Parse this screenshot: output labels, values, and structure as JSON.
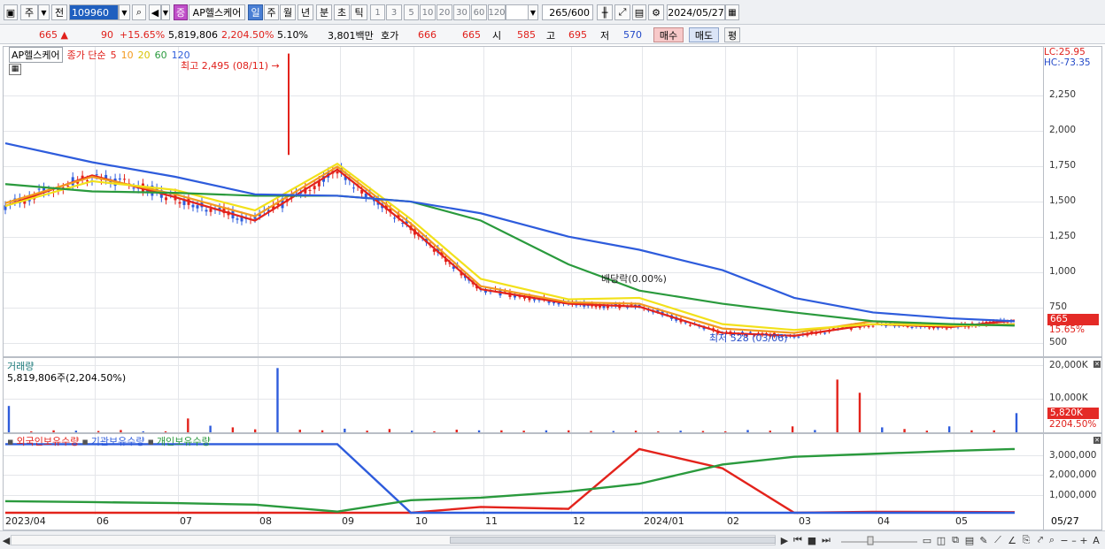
{
  "toolbar": {
    "market_type": "주",
    "prev_label": "전",
    "code": "109960",
    "badge": "증",
    "stock_name": "AP헬스케어",
    "periods": [
      "일",
      "주",
      "월",
      "년",
      "분",
      "초",
      "틱"
    ],
    "active_period": "일",
    "intervals": [
      "1",
      "3",
      "5",
      "10",
      "20",
      "30",
      "60",
      "120"
    ],
    "count": "265",
    "count_total": "/600",
    "date": "2024/05/27"
  },
  "quote": {
    "price": "665",
    "change_arrow": "▲",
    "change": "90",
    "change_pct": "+15.65%",
    "volume": "5,819,806",
    "volume_ratio": "2,204.50%",
    "turnover": "5.10%",
    "amount": "3,801백만",
    "hoga_label": "호가",
    "ask": "666",
    "bid": "665",
    "open_label": "시",
    "open": "585",
    "high_label": "고",
    "high": "695",
    "low_label": "저",
    "low": "570",
    "buy_label": "매수",
    "sell_label": "매도",
    "eval_label": "평"
  },
  "legend": {
    "name": "AP헬스케어",
    "indicator": "종가 단순",
    "ma": [
      {
        "label": "5",
        "color": "#e3231c"
      },
      {
        "label": "10",
        "color": "#f39a1e"
      },
      {
        "label": "20",
        "color": "#f2e11a"
      },
      {
        "label": "60",
        "color": "#2a9a3d"
      },
      {
        "label": "120",
        "color": "#2e5cdc"
      }
    ]
  },
  "annotations": {
    "high": "최고 2,495 (08/11)",
    "low": "최저 528 (03/06)",
    "dividend": "배당락(0.00%)"
  },
  "price_axis": {
    "lc": "LC:25.95",
    "hc": "HC:-73.35",
    "ticks": [
      "2,250",
      "2,000",
      "1,750",
      "1,500",
      "1,250",
      "1,000",
      "750",
      "500"
    ],
    "price_tag": "665",
    "pct_tag": "15.65%"
  },
  "volume_panel": {
    "title": "거래량",
    "value": "5,819,806주(2,204.50%)",
    "ticks": [
      "20,000K",
      "10,000K"
    ],
    "tag": "5,820K",
    "pct": "2204.50%"
  },
  "holding_panel": {
    "series": [
      {
        "label": "외국인보유수량",
        "color": "#e3231c"
      },
      {
        "label": "기관보유수량",
        "color": "#2e5cdc"
      },
      {
        "label": "개인보유수량",
        "color": "#2a9a3d"
      }
    ],
    "ticks": [
      "3,000,000",
      "2,000,000",
      "1,000,000"
    ]
  },
  "x_axis": {
    "labels": [
      "2023/04",
      "06",
      "07",
      "08",
      "09",
      "10",
      "11",
      "12",
      "2024/01",
      "02",
      "03",
      "04",
      "05"
    ],
    "end_label": "05/27"
  },
  "chart_data": [
    {
      "type": "line",
      "title": "AP헬스케어",
      "x": [
        "2023/04",
        "06",
        "07",
        "08",
        "09",
        "10",
        "11",
        "12",
        "2024/01",
        "02",
        "03",
        "04",
        "05",
        "05/27"
      ],
      "series": [
        {
          "name": "5",
          "values": [
            1450,
            1660,
            1510,
            1350,
            1700,
            1300,
            880,
            780,
            760,
            580,
            560,
            640,
            620,
            665
          ]
        },
        {
          "name": "10",
          "values": [
            1470,
            1650,
            1530,
            1380,
            1720,
            1330,
            900,
            790,
            780,
            610,
            580,
            660,
            630,
            640
          ]
        },
        {
          "name": "20",
          "values": [
            1450,
            1620,
            1560,
            1420,
            1740,
            1360,
            950,
            810,
            820,
            640,
            600,
            640,
            630,
            635
          ]
        },
        {
          "name": "60",
          "values": [
            1600,
            1550,
            1540,
            1520,
            1520,
            1480,
            1350,
            1050,
            870,
            780,
            720,
            660,
            640,
            630
          ]
        },
        {
          "name": "120",
          "values": [
            1880,
            1750,
            1650,
            1530,
            1520,
            1480,
            1400,
            1240,
            1150,
            1010,
            820,
            720,
            680,
            660
          ]
        }
      ],
      "ylim": [
        450,
        2450
      ],
      "ylabel": ""
    },
    {
      "type": "bar",
      "title": "거래량",
      "unit": "K",
      "values": [
        8000,
        300,
        600,
        500,
        400,
        700,
        300,
        300,
        4200,
        2000,
        1500,
        900,
        19500,
        800,
        600,
        1100,
        500,
        1000,
        500,
        300,
        800,
        600,
        600,
        500,
        600,
        600,
        400,
        400,
        500,
        300,
        500,
        400,
        300,
        700,
        500,
        1800,
        700,
        16000,
        12000,
        1500,
        1000,
        500,
        1800,
        600,
        600,
        5820
      ],
      "ylim": [
        0,
        22000
      ]
    },
    {
      "type": "line",
      "title": "보유수량",
      "x": [
        "2023/04",
        "06",
        "07",
        "08",
        "09",
        "10",
        "11",
        "12",
        "2024/01",
        "02",
        "03",
        "04",
        "05",
        "05/27"
      ],
      "series": [
        {
          "name": "외국인보유수량",
          "values": [
            0,
            0,
            0,
            0,
            0,
            0,
            300000,
            200000,
            3300000,
            2300000,
            0,
            50000,
            40000,
            30000
          ]
        },
        {
          "name": "기관보유수량",
          "values": [
            3550000,
            3550000,
            3550000,
            3550000,
            3550000,
            0,
            0,
            0,
            0,
            0,
            0,
            0,
            0,
            0
          ]
        },
        {
          "name": "개인보유수량",
          "values": [
            600000,
            550000,
            500000,
            420000,
            60000,
            650000,
            780000,
            1100000,
            1500000,
            2500000,
            2900000,
            3050000,
            3200000,
            3300000
          ]
        }
      ],
      "ylim": [
        0,
        3800000
      ]
    }
  ]
}
